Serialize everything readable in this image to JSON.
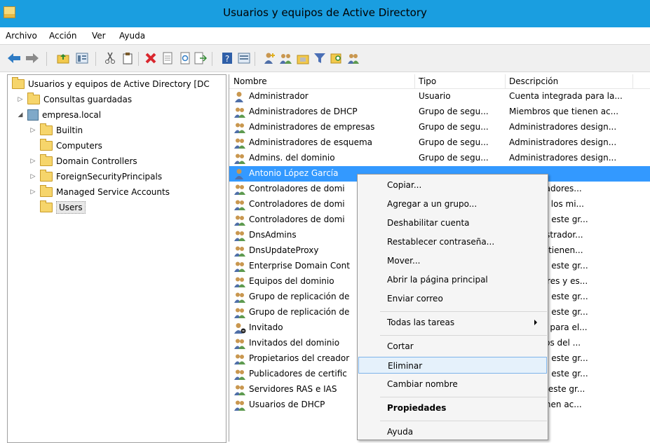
{
  "window": {
    "title": "Usuarios y equipos de Active Directory"
  },
  "menu": [
    "Archivo",
    "Acción",
    "Ver",
    "Ayuda"
  ],
  "toolbar_icons": [
    "back-icon",
    "forward-icon",
    "up-folder-icon",
    "show-hide-tree-icon",
    "cut-icon",
    "copy-icon",
    "delete-icon",
    "properties-icon",
    "refresh-icon",
    "export-list-icon",
    "help-icon",
    "view-icon",
    "new-user-icon",
    "new-group-icon",
    "new-ou-icon",
    "filter-icon",
    "find-icon",
    "add-to-group-icon"
  ],
  "tree": {
    "root": "Usuarios y equipos de Active Directory [DC",
    "items": [
      {
        "label": "Consultas guardadas",
        "level": 1,
        "expander": "▷"
      },
      {
        "label": "empresa.local",
        "level": 1,
        "expander": "◢"
      },
      {
        "label": "Builtin",
        "level": 2,
        "expander": "▷"
      },
      {
        "label": "Computers",
        "level": 2,
        "expander": ""
      },
      {
        "label": "Domain Controllers",
        "level": 2,
        "expander": "▷"
      },
      {
        "label": "ForeignSecurityPrincipals",
        "level": 2,
        "expander": "▷"
      },
      {
        "label": "Managed Service Accounts",
        "level": 2,
        "expander": "▷"
      },
      {
        "label": "Users",
        "level": 2,
        "expander": "",
        "selected": true
      }
    ]
  },
  "list": {
    "columns": [
      "Nombre",
      "Tipo",
      "Descripción"
    ],
    "rows": [
      {
        "name": "Administrador",
        "tipo": "Usuario",
        "desc": "Cuenta integrada para la...",
        "icon": "user-icon"
      },
      {
        "name": "Administradores de DHCP",
        "tipo": "Grupo de segu...",
        "desc": "Miembros que tienen ac...",
        "icon": "group-icon"
      },
      {
        "name": "Administradores de empresas",
        "tipo": "Grupo de segu...",
        "desc": "Administradores design...",
        "icon": "group-icon"
      },
      {
        "name": "Administradores de esquema",
        "tipo": "Grupo de segu...",
        "desc": "Administradores design...",
        "icon": "group-icon"
      },
      {
        "name": "Admins. del dominio",
        "tipo": "Grupo de segu...",
        "desc": "Administradores design...",
        "icon": "group-icon"
      },
      {
        "name": "Antonio López García",
        "tipo": "",
        "desc": "",
        "icon": "user-icon",
        "selected": true
      },
      {
        "name": "Controladores de domi",
        "tipo": "",
        "desc": "s controladores...",
        "icon": "group-icon"
      },
      {
        "name": "Controladores de domi",
        "tipo": "",
        "desc": "en clonar los mi...",
        "icon": "group-icon"
      },
      {
        "name": "Controladores de domi",
        "tipo": "",
        "desc": "mbros de este gr...",
        "icon": "group-icon"
      },
      {
        "name": "DnsAdmins",
        "tipo": "",
        "desc": "e administrador...",
        "icon": "group-icon"
      },
      {
        "name": "DnsUpdateProxy",
        "tipo": "",
        "desc": "DNS que tienen...",
        "icon": "group-icon"
      },
      {
        "name": "Enterprise Domain Cont",
        "tipo": "",
        "desc": "mbros de este gr...",
        "icon": "group-icon"
      },
      {
        "name": "Equipos del dominio",
        "tipo": "",
        "desc": "s servidores y es...",
        "icon": "group-icon"
      },
      {
        "name": "Grupo de replicación de",
        "tipo": "",
        "desc": "mbros de este gr...",
        "icon": "group-icon"
      },
      {
        "name": "Grupo de replicación de",
        "tipo": "",
        "desc": "mbros de este gr...",
        "icon": "group-icon"
      },
      {
        "name": "Invitado",
        "tipo": "",
        "desc": "ntegrada para el...",
        "icon": "disabled-user-icon"
      },
      {
        "name": "Invitados del dominio",
        "tipo": "",
        "desc": "s invitados del ...",
        "icon": "group-icon"
      },
      {
        "name": "Propietarios del creador",
        "tipo": "",
        "desc": "mbros de este gr...",
        "icon": "group-icon"
      },
      {
        "name": "Publicadores de certific",
        "tipo": "",
        "desc": "mbros de este gr...",
        "icon": "group-icon"
      },
      {
        "name": "Servidores RAS e IAS",
        "tipo": "",
        "desc": "dores de este gr...",
        "icon": "group-icon"
      },
      {
        "name": "Usuarios de DHCP",
        "tipo": "",
        "desc": "s que tienen ac...",
        "icon": "group-icon"
      }
    ]
  },
  "context_menu": {
    "items": [
      {
        "label": "Copiar...",
        "type": "item"
      },
      {
        "label": "Agregar a un grupo...",
        "type": "item"
      },
      {
        "label": "Deshabilitar cuenta",
        "type": "item"
      },
      {
        "label": "Restablecer contraseña...",
        "type": "item"
      },
      {
        "label": "Mover...",
        "type": "item"
      },
      {
        "label": "Abrir la página principal",
        "type": "item"
      },
      {
        "label": "Enviar correo",
        "type": "item"
      },
      {
        "type": "separator"
      },
      {
        "label": "Todas las tareas",
        "type": "submenu"
      },
      {
        "type": "separator"
      },
      {
        "label": "Cortar",
        "type": "item"
      },
      {
        "label": "Eliminar",
        "type": "item",
        "hover": true
      },
      {
        "label": "Cambiar nombre",
        "type": "item"
      },
      {
        "type": "separator"
      },
      {
        "label": "Propiedades",
        "type": "item",
        "bold": true
      },
      {
        "type": "separator"
      },
      {
        "label": "Ayuda",
        "type": "item"
      }
    ]
  },
  "colors": {
    "titlebar": "#1a9ee0",
    "selection": "#3399ff",
    "menu_hover": "#e5f1fb"
  }
}
